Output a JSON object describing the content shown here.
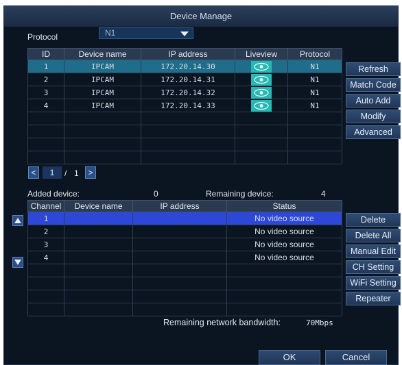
{
  "title": "Device Manage",
  "protocol": {
    "label": "Protocol",
    "value": "N1"
  },
  "search_table": {
    "headers": [
      "ID",
      "Device name",
      "IP address",
      "Liveview",
      "Protocol"
    ],
    "rows": [
      {
        "id": "1",
        "name": "IPCAM",
        "ip": "172.20.14.30",
        "protocol": "N1"
      },
      {
        "id": "2",
        "name": "IPCAM",
        "ip": "172.20.14.31",
        "protocol": "N1"
      },
      {
        "id": "3",
        "name": "IPCAM",
        "ip": "172.20.14.32",
        "protocol": "N1"
      },
      {
        "id": "4",
        "name": "IPCAM",
        "ip": "172.20.14.33",
        "protocol": "N1"
      }
    ]
  },
  "pager": {
    "current": "1",
    "separator": "/",
    "total": "1",
    "prev": "<",
    "next": ">"
  },
  "right_buttons_top": [
    "Refresh",
    "Match Code",
    "Auto Add",
    "Modify",
    "Advanced"
  ],
  "added": {
    "label": "Added device:",
    "value": "0",
    "remaining_label": "Remaining device:",
    "remaining_value": "4"
  },
  "added_table": {
    "headers": [
      "Channel",
      "Device name",
      "IP address",
      "Status"
    ],
    "rows": [
      {
        "channel": "1",
        "name": "",
        "ip": "",
        "status": "No video source"
      },
      {
        "channel": "2",
        "name": "",
        "ip": "",
        "status": "No video source"
      },
      {
        "channel": "3",
        "name": "",
        "ip": "",
        "status": "No video source"
      },
      {
        "channel": "4",
        "name": "",
        "ip": "",
        "status": "No video source"
      }
    ]
  },
  "right_buttons_bottom": [
    "Delete",
    "Delete All",
    "Manual Edit",
    "CH Setting",
    "WiFi Setting",
    "Repeater"
  ],
  "bandwidth": {
    "label": "Remaining network bandwidth:",
    "value": "70Mbps"
  },
  "footer": {
    "ok": "OK",
    "cancel": "Cancel"
  }
}
